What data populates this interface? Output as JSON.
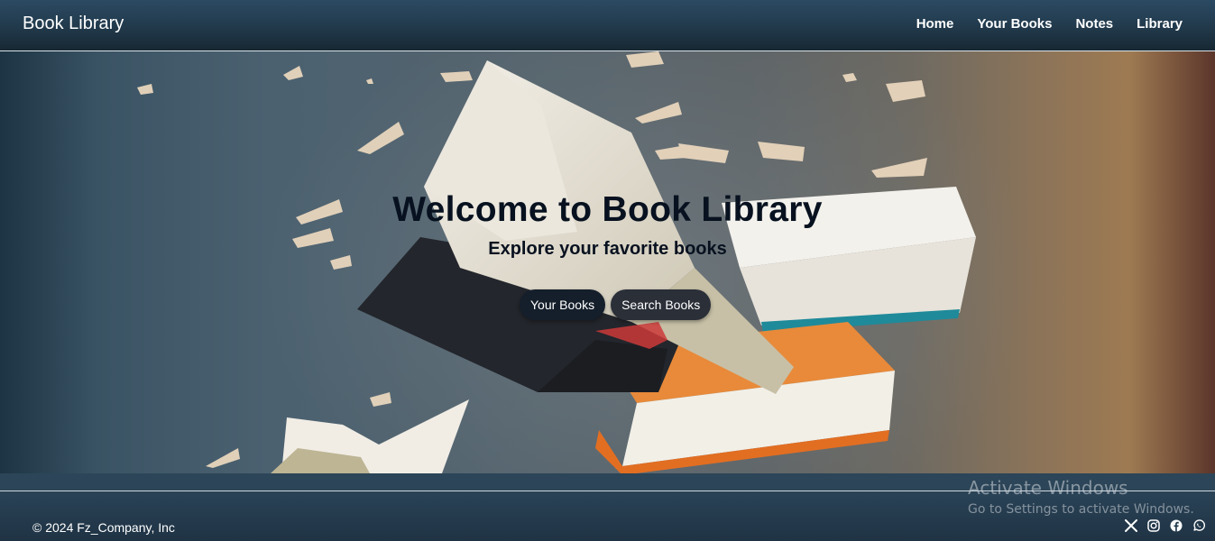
{
  "navbar": {
    "brand": "Book Library",
    "links": [
      "Home",
      "Your Books",
      "Notes",
      "Library"
    ]
  },
  "hero": {
    "title": "Welcome to Book Library",
    "subtitle": "Explore your favorite books",
    "buttons": [
      "Your Books",
      "Search Books"
    ]
  },
  "footer": {
    "copyright": "© 2024 Fz_Company, Inc",
    "social_icons": [
      "x-icon",
      "instagram-icon",
      "facebook-icon",
      "whatsapp-icon"
    ]
  },
  "watermark": {
    "title": "Activate Windows",
    "subtitle": "Go to Settings to activate Windows."
  },
  "colors": {
    "navbar": "#21394b",
    "hero_text": "#07111f",
    "button": "#151f2b",
    "footer": "#243b4e"
  }
}
